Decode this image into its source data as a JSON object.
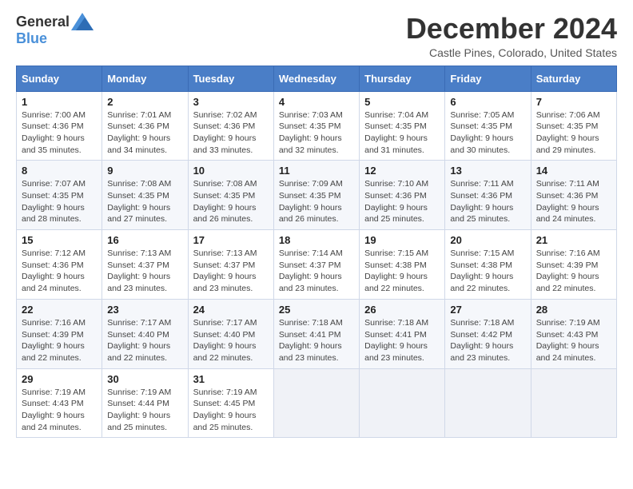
{
  "header": {
    "logo_general": "General",
    "logo_blue": "Blue",
    "month_title": "December 2024",
    "location": "Castle Pines, Colorado, United States"
  },
  "days_of_week": [
    "Sunday",
    "Monday",
    "Tuesday",
    "Wednesday",
    "Thursday",
    "Friday",
    "Saturday"
  ],
  "weeks": [
    [
      {
        "day": "1",
        "sunrise": "Sunrise: 7:00 AM",
        "sunset": "Sunset: 4:36 PM",
        "daylight": "Daylight: 9 hours and 35 minutes."
      },
      {
        "day": "2",
        "sunrise": "Sunrise: 7:01 AM",
        "sunset": "Sunset: 4:36 PM",
        "daylight": "Daylight: 9 hours and 34 minutes."
      },
      {
        "day": "3",
        "sunrise": "Sunrise: 7:02 AM",
        "sunset": "Sunset: 4:36 PM",
        "daylight": "Daylight: 9 hours and 33 minutes."
      },
      {
        "day": "4",
        "sunrise": "Sunrise: 7:03 AM",
        "sunset": "Sunset: 4:35 PM",
        "daylight": "Daylight: 9 hours and 32 minutes."
      },
      {
        "day": "5",
        "sunrise": "Sunrise: 7:04 AM",
        "sunset": "Sunset: 4:35 PM",
        "daylight": "Daylight: 9 hours and 31 minutes."
      },
      {
        "day": "6",
        "sunrise": "Sunrise: 7:05 AM",
        "sunset": "Sunset: 4:35 PM",
        "daylight": "Daylight: 9 hours and 30 minutes."
      },
      {
        "day": "7",
        "sunrise": "Sunrise: 7:06 AM",
        "sunset": "Sunset: 4:35 PM",
        "daylight": "Daylight: 9 hours and 29 minutes."
      }
    ],
    [
      {
        "day": "8",
        "sunrise": "Sunrise: 7:07 AM",
        "sunset": "Sunset: 4:35 PM",
        "daylight": "Daylight: 9 hours and 28 minutes."
      },
      {
        "day": "9",
        "sunrise": "Sunrise: 7:08 AM",
        "sunset": "Sunset: 4:35 PM",
        "daylight": "Daylight: 9 hours and 27 minutes."
      },
      {
        "day": "10",
        "sunrise": "Sunrise: 7:08 AM",
        "sunset": "Sunset: 4:35 PM",
        "daylight": "Daylight: 9 hours and 26 minutes."
      },
      {
        "day": "11",
        "sunrise": "Sunrise: 7:09 AM",
        "sunset": "Sunset: 4:35 PM",
        "daylight": "Daylight: 9 hours and 26 minutes."
      },
      {
        "day": "12",
        "sunrise": "Sunrise: 7:10 AM",
        "sunset": "Sunset: 4:36 PM",
        "daylight": "Daylight: 9 hours and 25 minutes."
      },
      {
        "day": "13",
        "sunrise": "Sunrise: 7:11 AM",
        "sunset": "Sunset: 4:36 PM",
        "daylight": "Daylight: 9 hours and 25 minutes."
      },
      {
        "day": "14",
        "sunrise": "Sunrise: 7:11 AM",
        "sunset": "Sunset: 4:36 PM",
        "daylight": "Daylight: 9 hours and 24 minutes."
      }
    ],
    [
      {
        "day": "15",
        "sunrise": "Sunrise: 7:12 AM",
        "sunset": "Sunset: 4:36 PM",
        "daylight": "Daylight: 9 hours and 24 minutes."
      },
      {
        "day": "16",
        "sunrise": "Sunrise: 7:13 AM",
        "sunset": "Sunset: 4:37 PM",
        "daylight": "Daylight: 9 hours and 23 minutes."
      },
      {
        "day": "17",
        "sunrise": "Sunrise: 7:13 AM",
        "sunset": "Sunset: 4:37 PM",
        "daylight": "Daylight: 9 hours and 23 minutes."
      },
      {
        "day": "18",
        "sunrise": "Sunrise: 7:14 AM",
        "sunset": "Sunset: 4:37 PM",
        "daylight": "Daylight: 9 hours and 23 minutes."
      },
      {
        "day": "19",
        "sunrise": "Sunrise: 7:15 AM",
        "sunset": "Sunset: 4:38 PM",
        "daylight": "Daylight: 9 hours and 22 minutes."
      },
      {
        "day": "20",
        "sunrise": "Sunrise: 7:15 AM",
        "sunset": "Sunset: 4:38 PM",
        "daylight": "Daylight: 9 hours and 22 minutes."
      },
      {
        "day": "21",
        "sunrise": "Sunrise: 7:16 AM",
        "sunset": "Sunset: 4:39 PM",
        "daylight": "Daylight: 9 hours and 22 minutes."
      }
    ],
    [
      {
        "day": "22",
        "sunrise": "Sunrise: 7:16 AM",
        "sunset": "Sunset: 4:39 PM",
        "daylight": "Daylight: 9 hours and 22 minutes."
      },
      {
        "day": "23",
        "sunrise": "Sunrise: 7:17 AM",
        "sunset": "Sunset: 4:40 PM",
        "daylight": "Daylight: 9 hours and 22 minutes."
      },
      {
        "day": "24",
        "sunrise": "Sunrise: 7:17 AM",
        "sunset": "Sunset: 4:40 PM",
        "daylight": "Daylight: 9 hours and 22 minutes."
      },
      {
        "day": "25",
        "sunrise": "Sunrise: 7:18 AM",
        "sunset": "Sunset: 4:41 PM",
        "daylight": "Daylight: 9 hours and 23 minutes."
      },
      {
        "day": "26",
        "sunrise": "Sunrise: 7:18 AM",
        "sunset": "Sunset: 4:41 PM",
        "daylight": "Daylight: 9 hours and 23 minutes."
      },
      {
        "day": "27",
        "sunrise": "Sunrise: 7:18 AM",
        "sunset": "Sunset: 4:42 PM",
        "daylight": "Daylight: 9 hours and 23 minutes."
      },
      {
        "day": "28",
        "sunrise": "Sunrise: 7:19 AM",
        "sunset": "Sunset: 4:43 PM",
        "daylight": "Daylight: 9 hours and 24 minutes."
      }
    ],
    [
      {
        "day": "29",
        "sunrise": "Sunrise: 7:19 AM",
        "sunset": "Sunset: 4:43 PM",
        "daylight": "Daylight: 9 hours and 24 minutes."
      },
      {
        "day": "30",
        "sunrise": "Sunrise: 7:19 AM",
        "sunset": "Sunset: 4:44 PM",
        "daylight": "Daylight: 9 hours and 25 minutes."
      },
      {
        "day": "31",
        "sunrise": "Sunrise: 7:19 AM",
        "sunset": "Sunset: 4:45 PM",
        "daylight": "Daylight: 9 hours and 25 minutes."
      },
      null,
      null,
      null,
      null
    ]
  ]
}
